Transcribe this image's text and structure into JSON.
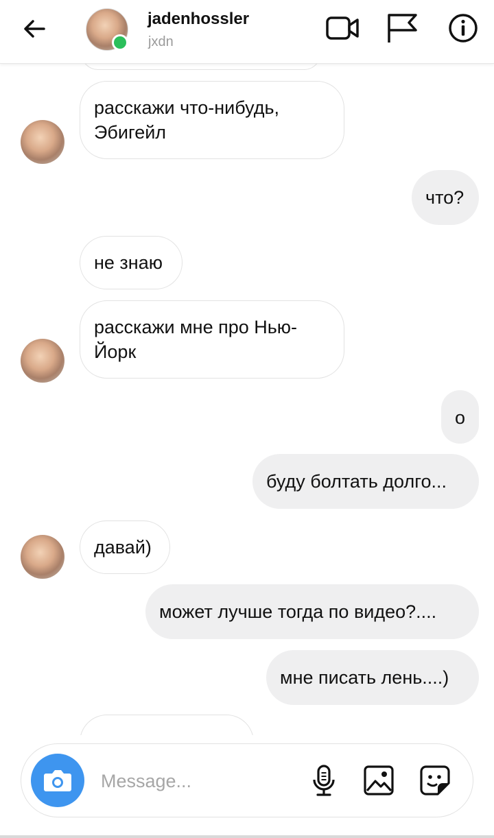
{
  "header": {
    "username": "jadenhossler",
    "handle": "jxdn"
  },
  "messages": [
    {
      "side": "incoming",
      "text": "расскажи что-нибудь, Эбигейл"
    },
    {
      "side": "outgoing",
      "text": "что?"
    },
    {
      "side": "incoming",
      "text": "не знаю"
    },
    {
      "side": "incoming",
      "text": "расскажи мне про Нью-Йорк"
    },
    {
      "side": "outgoing",
      "text": "о"
    },
    {
      "side": "outgoing",
      "text": "буду болтать долго..."
    },
    {
      "side": "incoming",
      "text": "давай)"
    },
    {
      "side": "outgoing",
      "text": "может лучше тогда по видео?...."
    },
    {
      "side": "outgoing",
      "text": "мне писать лень....)"
    }
  ],
  "composer": {
    "placeholder": "Message..."
  },
  "icons": {
    "back": "arrow-left-icon",
    "video": "video-camera-icon",
    "flag": "flag-icon",
    "info": "info-icon",
    "camera": "camera-icon",
    "mic": "microphone-icon",
    "gallery": "image-icon",
    "sticker": "sticker-icon"
  },
  "colors": {
    "accent": "#3e95ef",
    "online": "#2bbf5b",
    "outgoing_bubble": "#efeff0"
  }
}
